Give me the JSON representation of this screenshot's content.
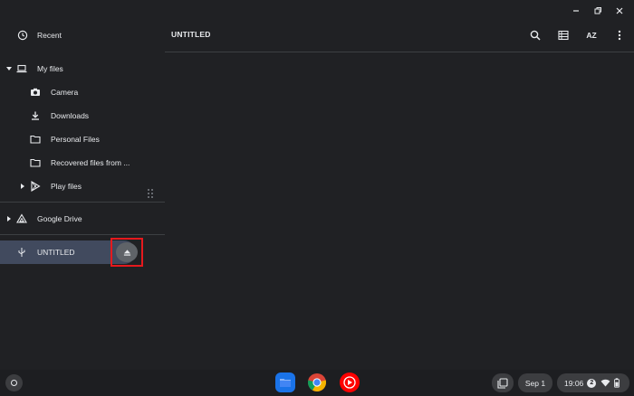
{
  "window": {
    "controls": [
      "minimize-icon",
      "restore-icon",
      "close-icon"
    ]
  },
  "sidebar": {
    "recent": {
      "label": "Recent",
      "icon": "clock-icon"
    },
    "my_files": {
      "label": "My files",
      "icon": "laptop-icon",
      "children": [
        {
          "label": "Camera",
          "icon": "camera-folder-icon"
        },
        {
          "label": "Downloads",
          "icon": "download-icon"
        },
        {
          "label": "Personal Files",
          "icon": "folder-icon"
        },
        {
          "label": "Recovered files from ...",
          "icon": "folder-icon"
        },
        {
          "label": "Play files",
          "icon": "play-store-icon"
        }
      ]
    },
    "google_drive": {
      "label": "Google Drive",
      "icon": "drive-icon"
    },
    "usb": {
      "label": "UNTITLED",
      "icon": "usb-icon",
      "eject_icon": "eject-icon",
      "selected": true
    }
  },
  "main": {
    "title": "UNTITLED",
    "toolbar": [
      "search-icon",
      "list-view-icon",
      "sort-az-icon",
      "more-vert-icon"
    ],
    "sort_label": "AZ"
  },
  "shelf": {
    "apps": [
      "files-app-icon",
      "chrome-icon",
      "youtube-music-icon"
    ],
    "date": "Sep 1",
    "time": "19:06",
    "notification_count": "2",
    "status_icons": [
      "wifi-icon",
      "battery-icon"
    ]
  },
  "colors": {
    "background": "#202124",
    "selected_row": "#414a5e",
    "highlight_box": "#e5191d",
    "shelf": "#1d1e21"
  }
}
